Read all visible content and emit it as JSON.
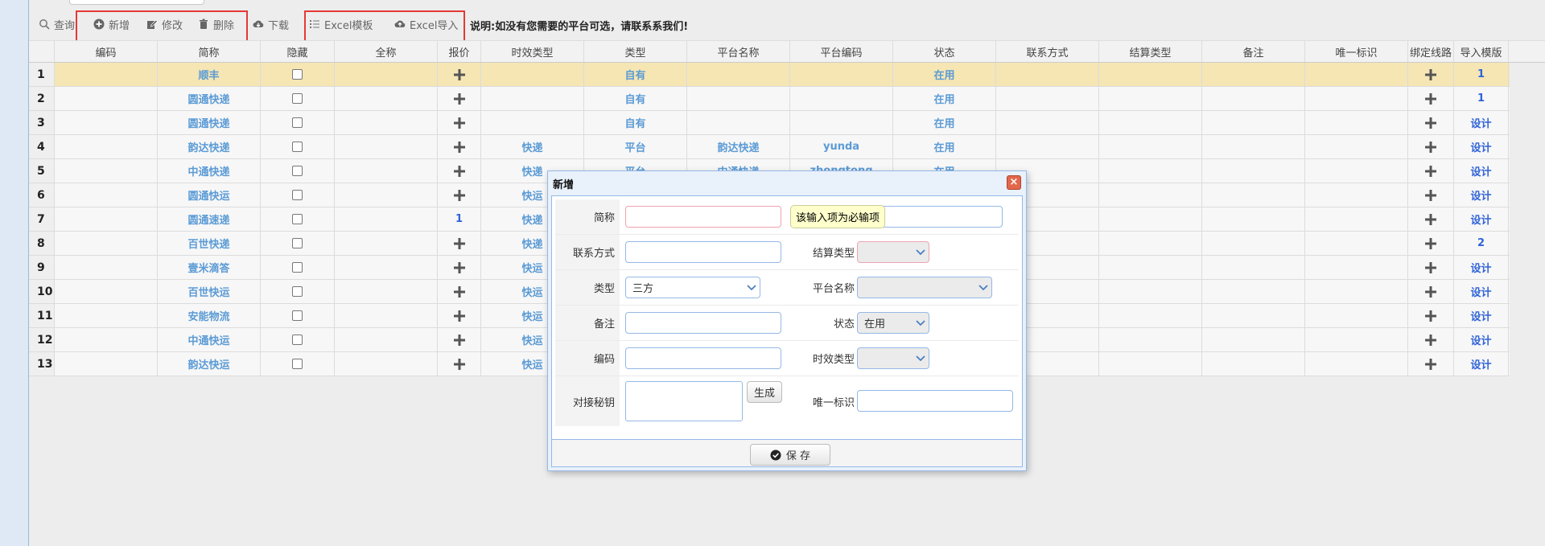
{
  "toolbar": {
    "query": "查询",
    "add": "新增",
    "edit": "修改",
    "delete": "删除",
    "download": "下载",
    "excel_template": "Excel模板",
    "excel_import": "Excel导入",
    "note": "说明:如没有您需要的平台可选，请联系系我们!"
  },
  "grid": {
    "headers": [
      "编码",
      "简称",
      "隐藏",
      "全称",
      "报价",
      "时效类型",
      "类型",
      "平台名称",
      "平台编码",
      "状态",
      "联系方式",
      "结算类型",
      "备注",
      "唯一标识",
      "绑定线路",
      "导入模版"
    ],
    "rows": [
      {
        "n": "1",
        "abbr": "顺丰",
        "price": "plus",
        "timeType": "",
        "type": "自有",
        "platform": "",
        "platformCode": "",
        "status": "在用",
        "tpl": "1"
      },
      {
        "n": "2",
        "abbr": "圆通快递",
        "price": "plus",
        "timeType": "",
        "type": "自有",
        "platform": "",
        "platformCode": "",
        "status": "在用",
        "tpl": "1"
      },
      {
        "n": "3",
        "abbr": "圆通快递",
        "price": "plus",
        "timeType": "",
        "type": "自有",
        "platform": "",
        "platformCode": "",
        "status": "在用",
        "tpl": "设计"
      },
      {
        "n": "4",
        "abbr": "韵达快递",
        "price": "plus",
        "timeType": "快递",
        "type": "平台",
        "platform": "韵达快递",
        "platformCode": "yunda",
        "status": "在用",
        "tpl": "设计"
      },
      {
        "n": "5",
        "abbr": "中通快递",
        "price": "plus",
        "timeType": "快递",
        "type": "平台",
        "platform": "中通快递",
        "platformCode": "zhongtong",
        "status": "在用",
        "tpl": "设计"
      },
      {
        "n": "6",
        "abbr": "圆通快运",
        "price": "plus",
        "timeType": "快运",
        "type": "",
        "platform": "",
        "platformCode": "",
        "status": "",
        "tpl": "设计"
      },
      {
        "n": "7",
        "abbr": "圆通速递",
        "price": "1",
        "timeType": "快递",
        "type": "",
        "platform": "",
        "platformCode": "",
        "status": "",
        "tpl": "设计"
      },
      {
        "n": "8",
        "abbr": "百世快递",
        "price": "plus",
        "timeType": "快递",
        "type": "",
        "platform": "",
        "platformCode": "",
        "status": "",
        "tpl": "2"
      },
      {
        "n": "9",
        "abbr": "壹米滴答",
        "price": "plus",
        "timeType": "快运",
        "type": "",
        "platform": "",
        "platformCode": "",
        "status": "",
        "tpl": "设计"
      },
      {
        "n": "10",
        "abbr": "百世快运",
        "price": "plus",
        "timeType": "快运",
        "type": "",
        "platform": "",
        "platformCode": "",
        "status": "",
        "tpl": "设计"
      },
      {
        "n": "11",
        "abbr": "安能物流",
        "price": "plus",
        "timeType": "快运",
        "type": "",
        "platform": "",
        "platformCode": "",
        "status": "",
        "tpl": "设计"
      },
      {
        "n": "12",
        "abbr": "中通快运",
        "price": "plus",
        "timeType": "快运",
        "type": "",
        "platform": "",
        "platformCode": "",
        "status": "",
        "tpl": "设计"
      },
      {
        "n": "13",
        "abbr": "韵达快运",
        "price": "plus",
        "timeType": "快运",
        "type": "",
        "platform": "",
        "platformCode": "",
        "status": "",
        "tpl": "设计"
      }
    ]
  },
  "modal": {
    "title": "新增",
    "close": "×",
    "labels": {
      "abbr": "简称",
      "contact": "联系方式",
      "settle": "结算类型",
      "type": "类型",
      "platform": "平台名称",
      "remark": "备注",
      "status": "状态",
      "code": "编码",
      "timeType": "时效类型",
      "secret": "对接秘钥",
      "uid": "唯一标识"
    },
    "values": {
      "type": "三方",
      "status": "在用"
    },
    "tooltip": "该输入项为必输项",
    "generate": "生成",
    "save": "保 存"
  },
  "colors": {
    "accent": "#95b8e7",
    "link": "#5b9bd5",
    "selected_row": "#f5e6b4",
    "red_box": "#e53935"
  }
}
